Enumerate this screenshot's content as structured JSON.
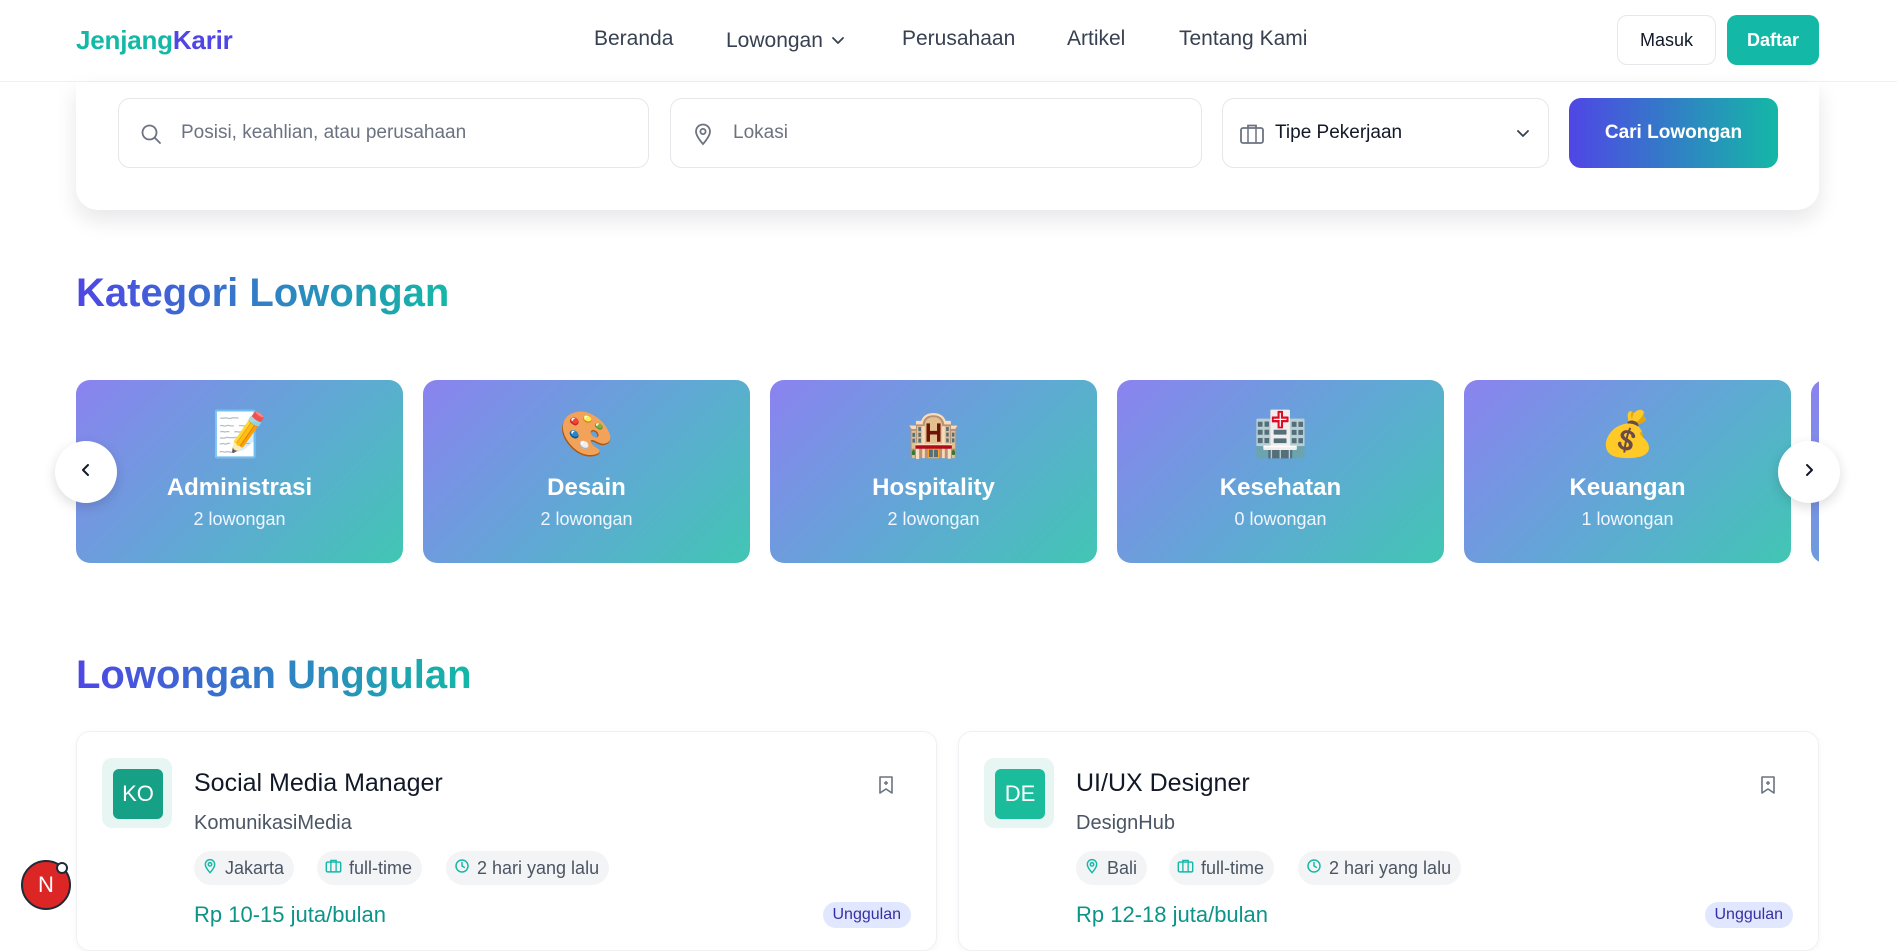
{
  "brand": {
    "part1": "Jenjang",
    "part2": "Karir"
  },
  "nav": {
    "items": [
      "Beranda",
      "Lowongan",
      "Perusahaan",
      "Artikel",
      "Tentang Kami"
    ],
    "login": "Masuk",
    "register": "Daftar"
  },
  "search": {
    "keyword_placeholder": "Posisi, keahlian, atau perusahaan",
    "location_placeholder": "Lokasi",
    "type_selected": "Tipe Pekerjaan",
    "button": "Cari Lowongan"
  },
  "categories": {
    "title_part1": "Kategori",
    "title_part2": "Lowongan",
    "items": [
      {
        "emoji": "📝",
        "name": "Administrasi",
        "count": "2 lowongan"
      },
      {
        "emoji": "🎨",
        "name": "Desain",
        "count": "2 lowongan"
      },
      {
        "emoji": "🏨",
        "name": "Hospitality",
        "count": "2 lowongan"
      },
      {
        "emoji": "🏥",
        "name": "Kesehatan",
        "count": "0 lowongan"
      },
      {
        "emoji": "💰",
        "name": "Keuangan",
        "count": "1 lowongan"
      }
    ]
  },
  "featured": {
    "title_part1": "Lowongan",
    "title_part2": "Unggulan",
    "jobs": [
      {
        "initials": "KO",
        "logo_color": "#16a085",
        "title": "Social Media Manager",
        "company": "KomunikasiMedia",
        "location": "Jakarta",
        "type": "full-time",
        "posted": "2 hari yang lalu",
        "salary": "Rp 10-15 juta/bulan",
        "badge": "Unggulan"
      },
      {
        "initials": "DE",
        "logo_color": "#1abc9c",
        "title": "UI/UX Designer",
        "company": "DesignHub",
        "location": "Bali",
        "type": "full-time",
        "posted": "2 hari yang lalu",
        "salary": "Rp 12-18 juta/bulan",
        "badge": "Unggulan"
      }
    ]
  },
  "dev_indicator": {
    "label": "N"
  }
}
